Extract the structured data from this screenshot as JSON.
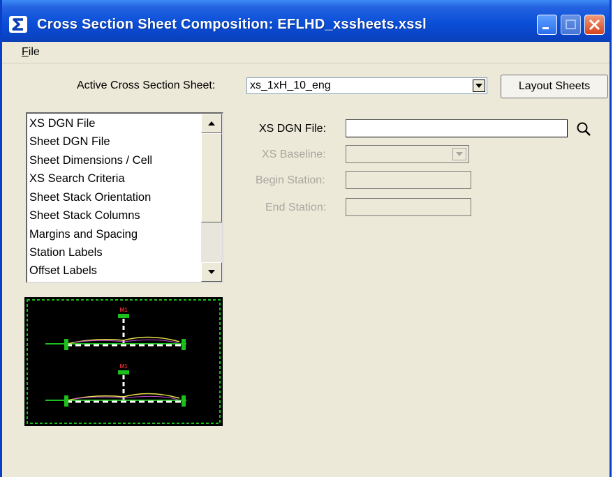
{
  "window": {
    "title": "Cross Section Sheet Composition: EFLHD_xssheets.xssl"
  },
  "menu": {
    "file": "File"
  },
  "sheet": {
    "label": "Active Cross Section Sheet:",
    "value": "xs_1xH_10_eng",
    "layout_button": "Layout Sheets"
  },
  "categories": [
    "XS DGN File",
    "Sheet DGN File",
    "Sheet Dimensions / Cell",
    "XS Search Criteria",
    "Sheet Stack Orientation",
    "Sheet Stack Columns",
    "Margins and Spacing",
    "Station Labels",
    "Offset Labels"
  ],
  "form": {
    "xs_dgn_file": {
      "label": "XS DGN File:",
      "value": ""
    },
    "xs_baseline": {
      "label": "XS Baseline:",
      "value": ""
    },
    "begin_station": {
      "label": "Begin Station:",
      "value": ""
    },
    "end_station": {
      "label": "End Station:",
      "value": ""
    }
  },
  "preview": {
    "marker_label": "M1"
  },
  "colors": {
    "titlebar": "#0a4fd8",
    "window_bg": "#ece9d8",
    "preview_border": "#1dbf1d",
    "close_button": "#d6431c"
  },
  "icons": {
    "app": "app-s-icon",
    "search": "magnifier-icon"
  }
}
